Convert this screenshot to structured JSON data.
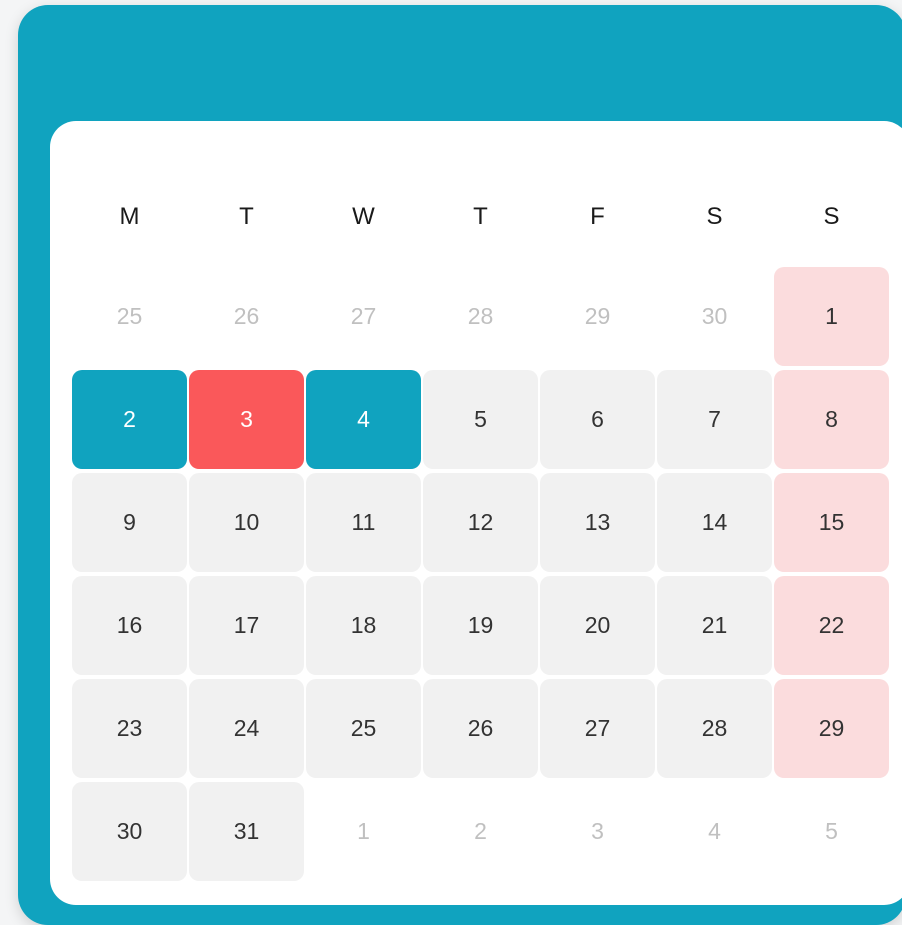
{
  "calendar": {
    "weekdays": [
      "M",
      "T",
      "W",
      "T",
      "F",
      "S",
      "S"
    ],
    "colors": {
      "header": "#10a3bf",
      "selected": "#10a3bf",
      "today": "#fa585a",
      "weekend": "#fbdcdd",
      "day_bg": "#f1f1f1",
      "muted_text": "#c0c0c0"
    },
    "weeks": [
      [
        {
          "label": "25",
          "state": "other"
        },
        {
          "label": "26",
          "state": "other"
        },
        {
          "label": "27",
          "state": "other"
        },
        {
          "label": "28",
          "state": "other"
        },
        {
          "label": "29",
          "state": "other"
        },
        {
          "label": "30",
          "state": "other"
        },
        {
          "label": "1",
          "state": "weekend"
        }
      ],
      [
        {
          "label": "2",
          "state": "selected"
        },
        {
          "label": "3",
          "state": "today"
        },
        {
          "label": "4",
          "state": "selected"
        },
        {
          "label": "5",
          "state": "normal"
        },
        {
          "label": "6",
          "state": "normal"
        },
        {
          "label": "7",
          "state": "normal"
        },
        {
          "label": "8",
          "state": "weekend"
        }
      ],
      [
        {
          "label": "9",
          "state": "normal"
        },
        {
          "label": "10",
          "state": "normal"
        },
        {
          "label": "11",
          "state": "normal"
        },
        {
          "label": "12",
          "state": "normal"
        },
        {
          "label": "13",
          "state": "normal"
        },
        {
          "label": "14",
          "state": "normal"
        },
        {
          "label": "15",
          "state": "weekend"
        }
      ],
      [
        {
          "label": "16",
          "state": "normal"
        },
        {
          "label": "17",
          "state": "normal"
        },
        {
          "label": "18",
          "state": "normal"
        },
        {
          "label": "19",
          "state": "normal"
        },
        {
          "label": "20",
          "state": "normal"
        },
        {
          "label": "21",
          "state": "normal"
        },
        {
          "label": "22",
          "state": "weekend"
        }
      ],
      [
        {
          "label": "23",
          "state": "normal"
        },
        {
          "label": "24",
          "state": "normal"
        },
        {
          "label": "25",
          "state": "normal"
        },
        {
          "label": "26",
          "state": "normal"
        },
        {
          "label": "27",
          "state": "normal"
        },
        {
          "label": "28",
          "state": "normal"
        },
        {
          "label": "29",
          "state": "weekend"
        }
      ],
      [
        {
          "label": "30",
          "state": "normal"
        },
        {
          "label": "31",
          "state": "normal"
        },
        {
          "label": "1",
          "state": "other"
        },
        {
          "label": "2",
          "state": "other"
        },
        {
          "label": "3",
          "state": "other"
        },
        {
          "label": "4",
          "state": "other"
        },
        {
          "label": "5",
          "state": "other"
        }
      ]
    ]
  }
}
